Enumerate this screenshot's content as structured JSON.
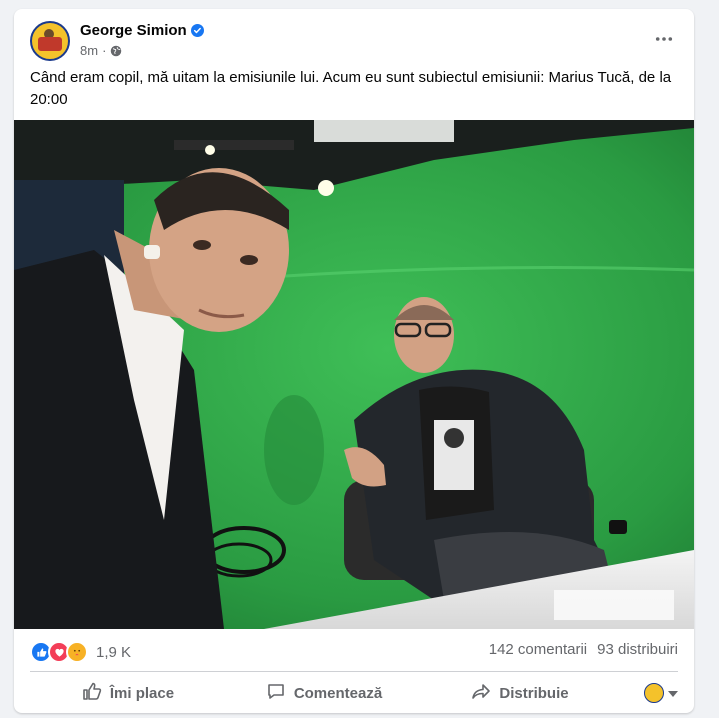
{
  "post": {
    "author": "George Simion",
    "time": "8m",
    "text": "Când eram copil, mă uitam la emisiunile lui. Acum eu sunt subiectul emisiunii: Marius Tucă, de la 20:00"
  },
  "icons": {
    "verified": "verified-badge-icon",
    "privacy": "globe-icon",
    "more": "more-options-icon",
    "like": "thumbs-up-icon",
    "comment": "comment-bubble-icon",
    "share": "share-arrow-icon",
    "dropdown": "chevron-down-icon"
  },
  "stats": {
    "reactions_count": "1,9 K",
    "comments": "142 comentarii",
    "shares": "93 distribuiri"
  },
  "actions": {
    "like_label": "Îmi place",
    "comment_label": "Comentează",
    "share_label": "Distribuie"
  },
  "colors": {
    "accent": "#1877f2",
    "green_screen": "#2fa847"
  }
}
